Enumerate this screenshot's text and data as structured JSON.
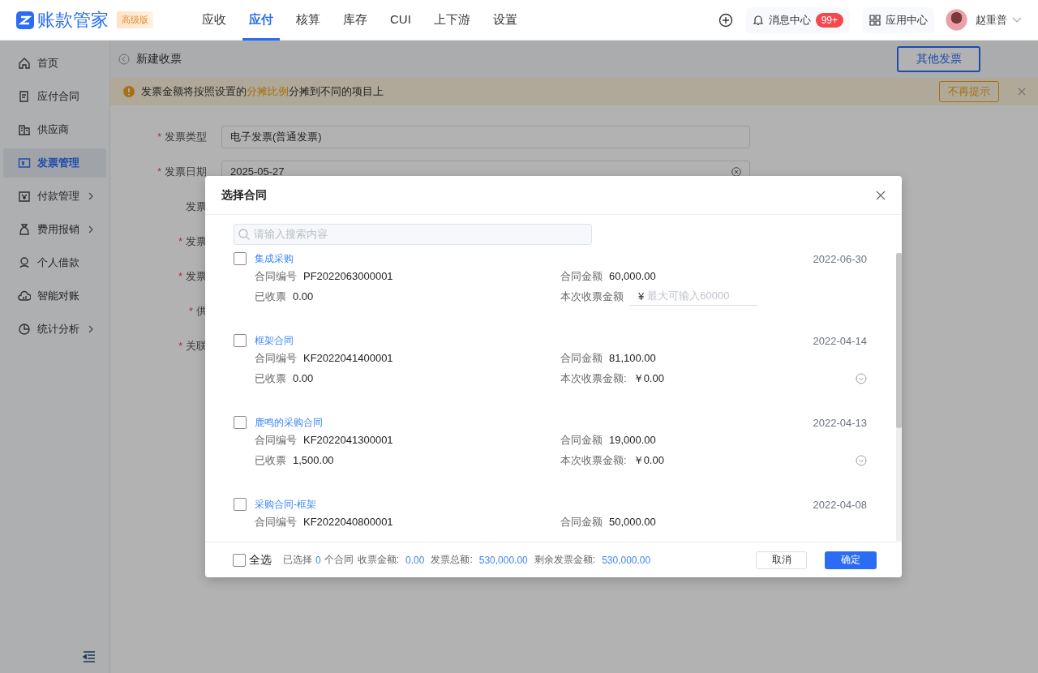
{
  "header": {
    "logo": "账款管家",
    "edition": "高级版",
    "nav": [
      {
        "label": "应收",
        "selected": false
      },
      {
        "label": "应付",
        "selected": true
      },
      {
        "label": "核算",
        "selected": false
      },
      {
        "label": "库存",
        "selected": false
      },
      {
        "label": "CUI",
        "selected": false
      },
      {
        "label": "上下游",
        "selected": false
      },
      {
        "label": "设置",
        "selected": false
      }
    ],
    "messages": {
      "label": "消息中心",
      "badge": "99+"
    },
    "apps": "应用中心",
    "user": "赵重普"
  },
  "sidebar": {
    "items": [
      {
        "label": "首页",
        "selected": false,
        "expandable": false
      },
      {
        "label": "应付合同",
        "selected": false,
        "expandable": false
      },
      {
        "label": "供应商",
        "selected": false,
        "expandable": false
      },
      {
        "label": "发票管理",
        "selected": true,
        "expandable": false
      },
      {
        "label": "付款管理",
        "selected": false,
        "expandable": true
      },
      {
        "label": "费用报销",
        "selected": false,
        "expandable": true
      },
      {
        "label": "个人借款",
        "selected": false,
        "expandable": false
      },
      {
        "label": "智能对账",
        "selected": false,
        "expandable": false
      },
      {
        "label": "统计分析",
        "selected": false,
        "expandable": true
      }
    ]
  },
  "page": {
    "title": "新建收票",
    "action": "其他发票",
    "alert": {
      "before": "发票金额将按照设置的",
      "link": "分摊比例",
      "after": "分摊到不同的项目上",
      "dismiss": "不再提示"
    },
    "form": [
      {
        "mark": "*",
        "label": "发票类型",
        "value": "电子发票(普通发票)",
        "kind": "text"
      },
      {
        "mark": "*",
        "label": "发票日期",
        "value": "2025-05-27",
        "kind": "date"
      },
      {
        "label": "发票",
        "kind": "hidden"
      },
      {
        "mark": "*",
        "label": "发票",
        "kind": "hidden"
      },
      {
        "mark": "*",
        "label": "发票",
        "kind": "hidden"
      },
      {
        "mark": "*",
        "label": "供",
        "kind": "hidden"
      },
      {
        "mark": "*",
        "label": "关联",
        "kind": "hidden"
      }
    ]
  },
  "dialog": {
    "title": "选择合同",
    "search": {
      "placeholder": "请输入搜索内容"
    },
    "contracts": [
      {
        "name": "集成采购",
        "date": "2022-06-30",
        "checked": false,
        "number_label": "合同编号",
        "number": "PF2022063000001",
        "amount_label": "合同金额",
        "amount": "60,000.00",
        "received_label": "已收票",
        "received": "0.00",
        "kind": "input",
        "this_label": "本次收票金额",
        "currency": "¥",
        "placeholder": "最大可输入60000"
      },
      {
        "name": "框架合同",
        "date": "2022-04-14",
        "checked": false,
        "number_label": "合同编号",
        "number": "KF2022041400001",
        "amount_label": "合同金额",
        "amount": "81,100.00",
        "received_label": "已收票",
        "received": "0.00",
        "kind": "amount",
        "this_label": "本次收票金额:",
        "this_value": "￥0.00"
      },
      {
        "name": "鹿鸣的采购合同",
        "date": "2022-04-13",
        "checked": false,
        "number_label": "合同编号",
        "number": "KF2022041300001",
        "amount_label": "合同金额",
        "amount": "19,000.00",
        "received_label": "已收票",
        "received": "1,500.00",
        "kind": "amount",
        "this_label": "本次收票金额:",
        "this_value": "￥0.00"
      },
      {
        "name": "采购合同-框架",
        "date": "2022-04-08",
        "checked": false,
        "number_label": "合同编号",
        "number": "KF2022040800001",
        "amount_label": "合同金额",
        "amount": "50,000.00",
        "kind": "partial"
      }
    ],
    "footer": {
      "select_all": {
        "label": "全选",
        "checked": false
      },
      "selected_prefix": "已选择",
      "selected_count": "0",
      "selected_suffix": "个合同",
      "totals": [
        {
          "label": "收票金额:",
          "value": "0.00"
        },
        {
          "label": "发票总额:",
          "value": "530,000.00"
        },
        {
          "label": "剩余发票金额:",
          "value": "530,000.00"
        }
      ],
      "cancel": "取消",
      "confirm": "确定"
    }
  }
}
